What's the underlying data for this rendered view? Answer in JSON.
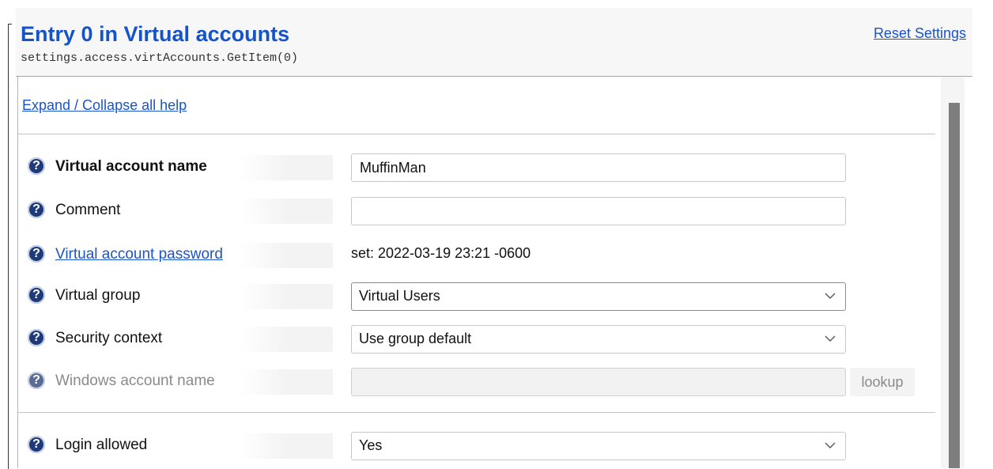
{
  "header": {
    "title": "Entry 0 in Virtual accounts",
    "path": "settings.access.virtAccounts.GetItem(0)",
    "reset_label": "Reset Settings"
  },
  "panel": {
    "expand_label": "Expand / Collapse all help"
  },
  "fields": {
    "name": {
      "label": "Virtual account name",
      "value": "MuffinMan"
    },
    "comment": {
      "label": "Comment",
      "value": ""
    },
    "password": {
      "label": "Virtual account password",
      "status": "set:  2022-03-19 23:21 -0600"
    },
    "group": {
      "label": "Virtual group",
      "selected": "Virtual Users"
    },
    "security": {
      "label": "Security context",
      "selected": "Use group default"
    },
    "windows": {
      "label": "Windows account name",
      "value": "",
      "lookup_label": "lookup"
    },
    "login": {
      "label": "Login allowed",
      "selected": "Yes"
    }
  },
  "icons": {
    "help": "question-mark-help-icon",
    "dropdown": "chevron-down-icon",
    "help_glyph": "?"
  },
  "colors": {
    "title": "#1454c8",
    "link": "#1a55c5",
    "help_icon": "#1e3a78"
  }
}
